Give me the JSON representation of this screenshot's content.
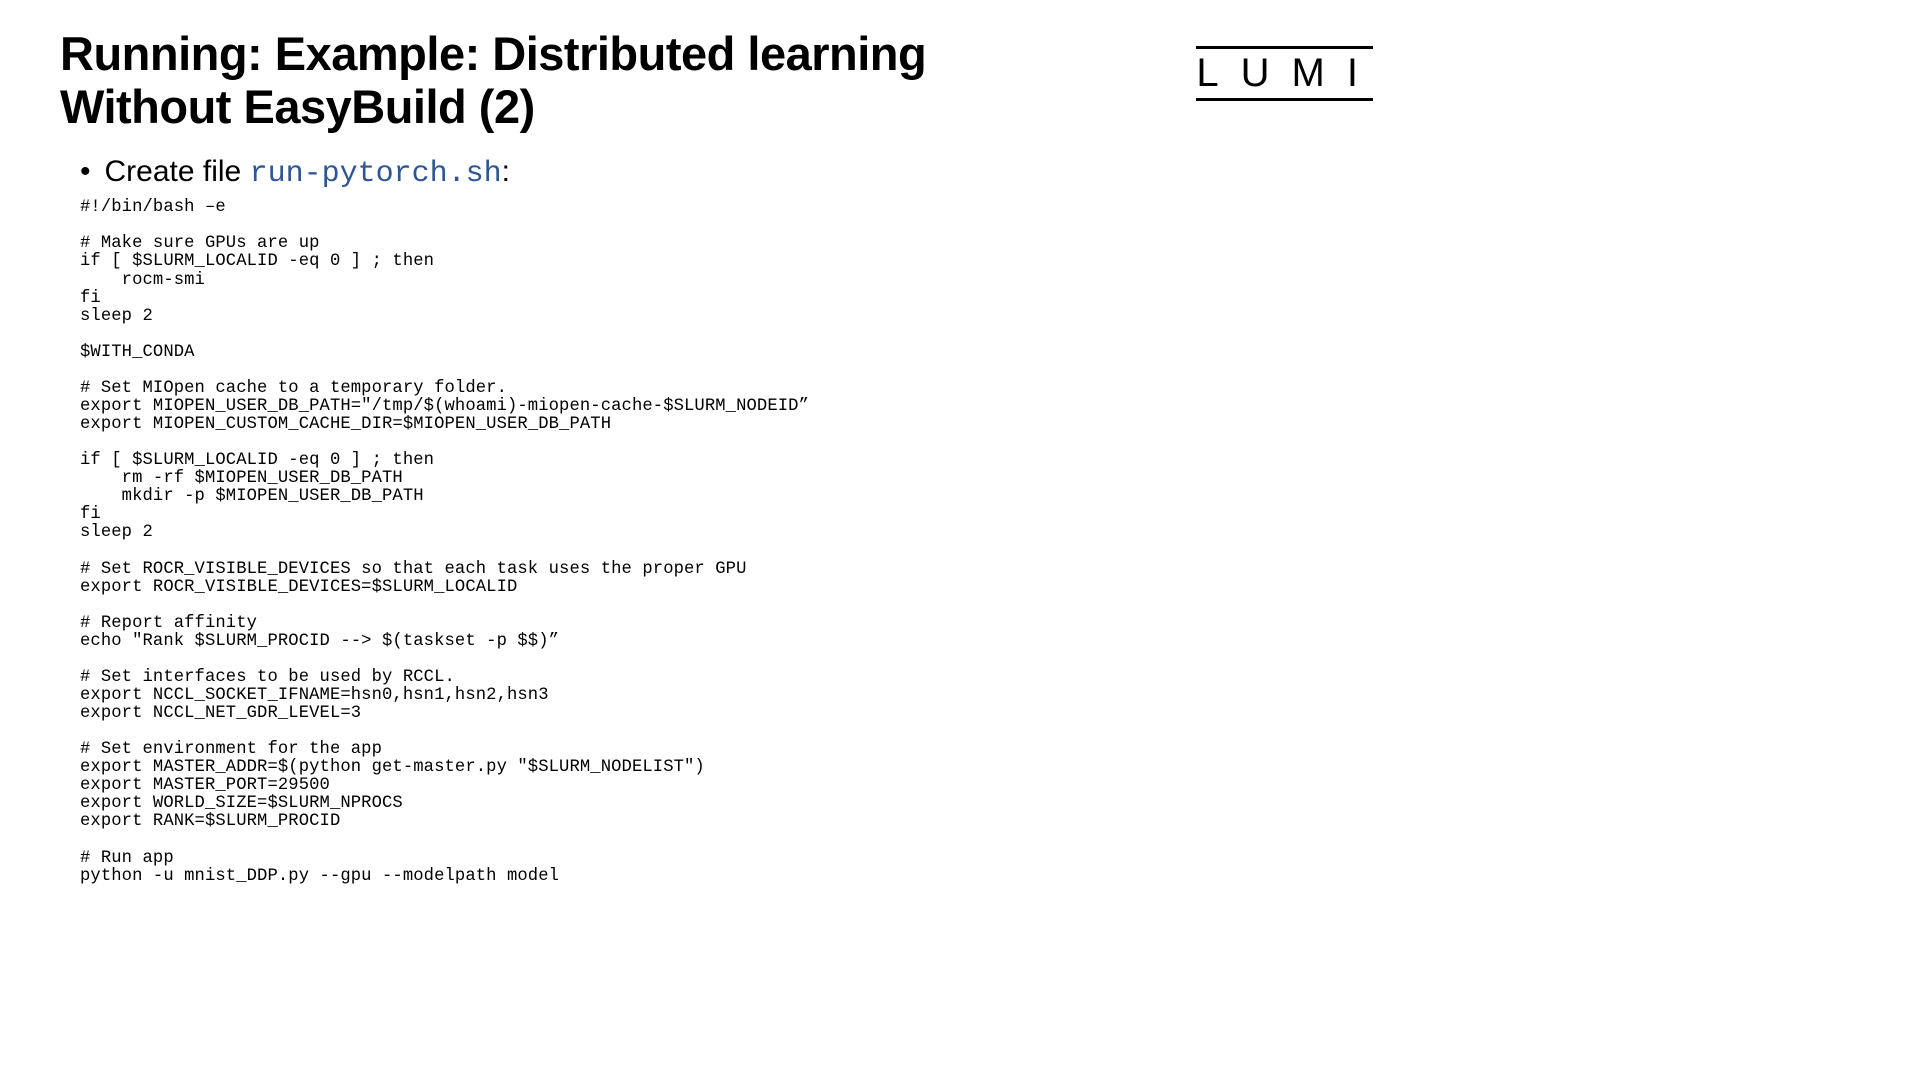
{
  "logo": "LUMI",
  "title": "Running: Example: Distributed learning Without EasyBuild (2)",
  "bullet": {
    "prefix": "Create file ",
    "filename": "run-pytorch.sh",
    "suffix": ":"
  },
  "code": "#!/bin/bash –e\n\n# Make sure GPUs are up\nif [ $SLURM_LOCALID -eq 0 ] ; then\n    rocm-smi\nfi\nsleep 2\n\n$WITH_CONDA\n\n# Set MIOpen cache to a temporary folder.\nexport MIOPEN_USER_DB_PATH=\"/tmp/$(whoami)-miopen-cache-$SLURM_NODEID”\nexport MIOPEN_CUSTOM_CACHE_DIR=$MIOPEN_USER_DB_PATH\n\nif [ $SLURM_LOCALID -eq 0 ] ; then\n    rm -rf $MIOPEN_USER_DB_PATH\n    mkdir -p $MIOPEN_USER_DB_PATH\nfi\nsleep 2\n\n# Set ROCR_VISIBLE_DEVICES so that each task uses the proper GPU\nexport ROCR_VISIBLE_DEVICES=$SLURM_LOCALID\n\n# Report affinity\necho \"Rank $SLURM_PROCID --> $(taskset -p $$)”\n\n# Set interfaces to be used by RCCL.\nexport NCCL_SOCKET_IFNAME=hsn0,hsn1,hsn2,hsn3\nexport NCCL_NET_GDR_LEVEL=3\n\n# Set environment for the app\nexport MASTER_ADDR=$(python get-master.py \"$SLURM_NODELIST\")\nexport MASTER_PORT=29500\nexport WORLD_SIZE=$SLURM_NPROCS\nexport RANK=$SLURM_PROCID\n\n# Run app\npython -u mnist_DDP.py --gpu --modelpath model"
}
